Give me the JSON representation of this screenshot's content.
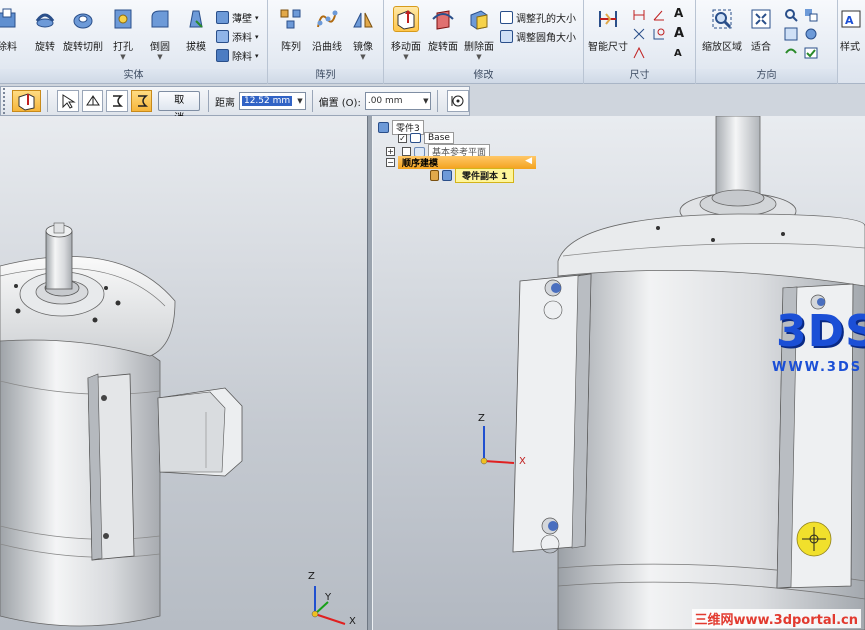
{
  "ribbon": {
    "groups": [
      {
        "label": "实体",
        "items": [
          "除料",
          "旋转",
          "旋转切削",
          "打孔",
          "倒圆",
          "拔模"
        ],
        "small": [
          "薄壁",
          "添料",
          "除料"
        ]
      },
      {
        "label": "阵列",
        "items": [
          "阵列",
          "沿曲线",
          "镜像"
        ]
      },
      {
        "label": "修改",
        "items": [
          "移动面",
          "旋转面",
          "删除面"
        ],
        "small": [
          "调整孔的大小",
          "调整圆角大小"
        ]
      },
      {
        "label": "尺寸",
        "items": [
          "智能尺寸"
        ]
      },
      {
        "label": "方向",
        "items": [
          "缩放区域",
          "适合"
        ]
      },
      {
        "label": "",
        "items": [
          "样式"
        ]
      }
    ]
  },
  "commandbar": {
    "cancel_label": "取消",
    "distance_label": "距离",
    "distance_value": "12.52 mm",
    "offset_label": "偏置 (O):",
    "offset_value": ".00 mm"
  },
  "tree": {
    "root": "零件3",
    "base": "Base",
    "ref_planes": "基本参考平面",
    "ordered": "顺序建模",
    "copy": "零件副本 1"
  },
  "triad": {
    "x": "X",
    "y": "Y",
    "z": "Z"
  },
  "watermark": {
    "logo": "3DS",
    "url": "WWW.3DS",
    "bottom": "三维网www.3dportal.cn"
  },
  "colors": {
    "accent": "#f6b53a",
    "selection": "#3163c5",
    "axis_x": "#e02020",
    "axis_y": "#18a018",
    "axis_z": "#2050d0",
    "watermark": "#1b4fd6"
  }
}
